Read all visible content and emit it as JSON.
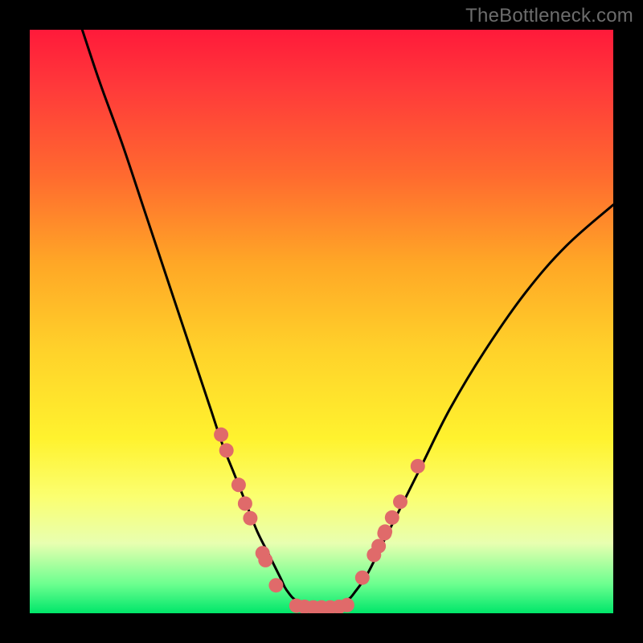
{
  "watermark": "TheBottleneck.com",
  "chart_data": {
    "type": "line",
    "title": "",
    "xlabel": "",
    "ylabel": "",
    "xlim": [
      0,
      100
    ],
    "ylim": [
      0,
      100
    ],
    "grid": false,
    "legend": false,
    "note": "Axes and gridlines are not rendered; values below are estimated in percentage of plot width/height measured from bottom-left. y represents height within the plot area (0 at bottom green band, 100 at top red).",
    "series": [
      {
        "name": "bottleneck-curve",
        "type": "line",
        "x": [
          9,
          12,
          16,
          20,
          24,
          28,
          31,
          33,
          35,
          37,
          39,
          41,
          43,
          44,
          46,
          50,
          54,
          56,
          58,
          60,
          63,
          67,
          72,
          78,
          85,
          92,
          100
        ],
        "y": [
          100,
          91,
          80,
          68,
          56,
          44,
          35,
          29,
          24,
          19,
          14,
          10,
          6,
          4,
          2,
          1,
          2,
          4,
          7,
          11,
          17,
          25,
          35,
          45,
          55,
          63,
          70
        ]
      },
      {
        "name": "left-dot-cluster",
        "type": "scatter",
        "x": [
          32.8,
          33.7,
          35.8,
          36.9,
          37.8,
          39.9,
          40.4,
          42.2
        ],
        "y": [
          30.6,
          27.9,
          22.0,
          18.8,
          16.3,
          10.3,
          9.1,
          4.8
        ]
      },
      {
        "name": "right-dot-cluster",
        "type": "scatter",
        "x": [
          57.0,
          59.0,
          59.8,
          60.8,
          60.9,
          62.1,
          63.5,
          66.5
        ],
        "y": [
          6.1,
          10.0,
          11.5,
          13.7,
          14.0,
          16.4,
          19.1,
          25.2
        ]
      },
      {
        "name": "valley-dot-cluster",
        "type": "scatter",
        "x": [
          45.7,
          47.1,
          48.6,
          50.0,
          51.5,
          53.0,
          54.4
        ],
        "y": [
          1.3,
          1.1,
          1.0,
          1.0,
          1.0,
          1.1,
          1.4
        ]
      }
    ],
    "colors": {
      "curve": "#000000",
      "dots": "#e06a6a",
      "background_top": "#ff1a3a",
      "background_bottom": "#00e66a"
    }
  }
}
